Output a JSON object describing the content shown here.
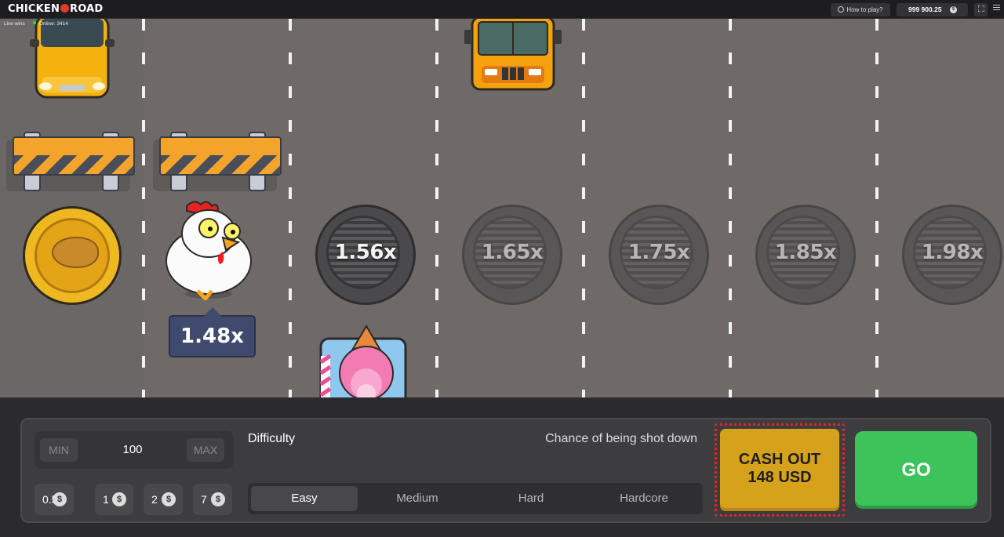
{
  "header": {
    "logo_text_left": "CHICKEN",
    "logo_text_right": "ROAD",
    "how_to_play": "How to play?",
    "balance": "999 900.25",
    "currency_symbol": "$"
  },
  "status": {
    "live_wins": "Live wins",
    "online": "Online: 3414"
  },
  "road": {
    "current_multiplier": "1.48x",
    "upcoming_multipliers": [
      "1.56x",
      "1.65x",
      "1.75x",
      "1.85x",
      "1.98x"
    ]
  },
  "controls": {
    "bet": {
      "min_label": "MIN",
      "max_label": "MAX",
      "value": "100",
      "quick_bets": [
        "0.5",
        "1",
        "2",
        "7"
      ]
    },
    "difficulty_label": "Difficulty",
    "chance_label": "Chance of being shot down",
    "difficulty_options": [
      "Easy",
      "Medium",
      "Hard",
      "Hardcore"
    ],
    "selected_difficulty": "Easy",
    "cash_out_line1": "CASH OUT",
    "cash_out_line2": "148 USD",
    "go_label": "GO"
  },
  "colors": {
    "go_green": "#3cc35a",
    "cashout_gold": "#d6a21b",
    "road_gray": "#6f6a68"
  }
}
